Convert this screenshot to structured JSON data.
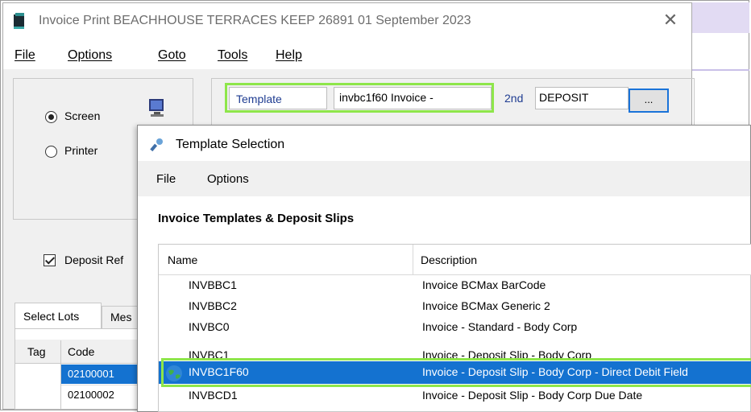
{
  "main_window": {
    "title": "Invoice Print BEACHHOUSE TERRACES KEEP 26891 01 September 2023",
    "menu": [
      "File",
      "Options",
      "Goto",
      "Tools",
      "Help"
    ],
    "output": {
      "options": [
        "Screen",
        "Printer"
      ],
      "selected": "Screen"
    },
    "template": {
      "label": "Template",
      "value": "invbc1f60 Invoice -",
      "second_label": "2nd",
      "second_value": "DEPOSIT",
      "browse_label": "..."
    },
    "deposit_checkbox": {
      "label": "Deposit Ref",
      "checked": true
    },
    "tabs": [
      "Select Lots",
      "Mes"
    ],
    "lots_table": {
      "columns": [
        "Tag",
        "Code"
      ],
      "rows": [
        {
          "code": "02100001",
          "selected": true
        },
        {
          "code": "02100002",
          "selected": false
        }
      ]
    }
  },
  "dialog": {
    "title": "Template Selection",
    "menu": [
      "File",
      "Options"
    ],
    "heading": "Invoice Templates & Deposit Slips",
    "columns": [
      "Name",
      "Description"
    ],
    "rows": [
      {
        "name": "INVBBC1",
        "description": "Invoice BCMax BarCode"
      },
      {
        "name": "INVBBC2",
        "description": "Invoice BCMax Generic 2"
      },
      {
        "name": "INVBC0",
        "description": "Invoice - Standard - Body Corp"
      },
      {
        "name": "INVBC1",
        "description": "Invoice - Deposit Slip - Body Corp"
      },
      {
        "name": "INVBC1F60",
        "description": "Invoice - Deposit Slip - Body Corp - Direct Debit Field",
        "selected": true
      },
      {
        "name": "INVBCD1",
        "description": "Invoice - Deposit Slip - Body Corp Due Date"
      }
    ]
  },
  "colors": {
    "selection": "#1472d0",
    "highlight": "#8ee64a",
    "label_blue": "#1f3c91"
  },
  "icons": [
    "app-book-icon",
    "close-icon",
    "monitor-icon",
    "wrench-icon",
    "globe-icon",
    "checkmark-icon"
  ]
}
